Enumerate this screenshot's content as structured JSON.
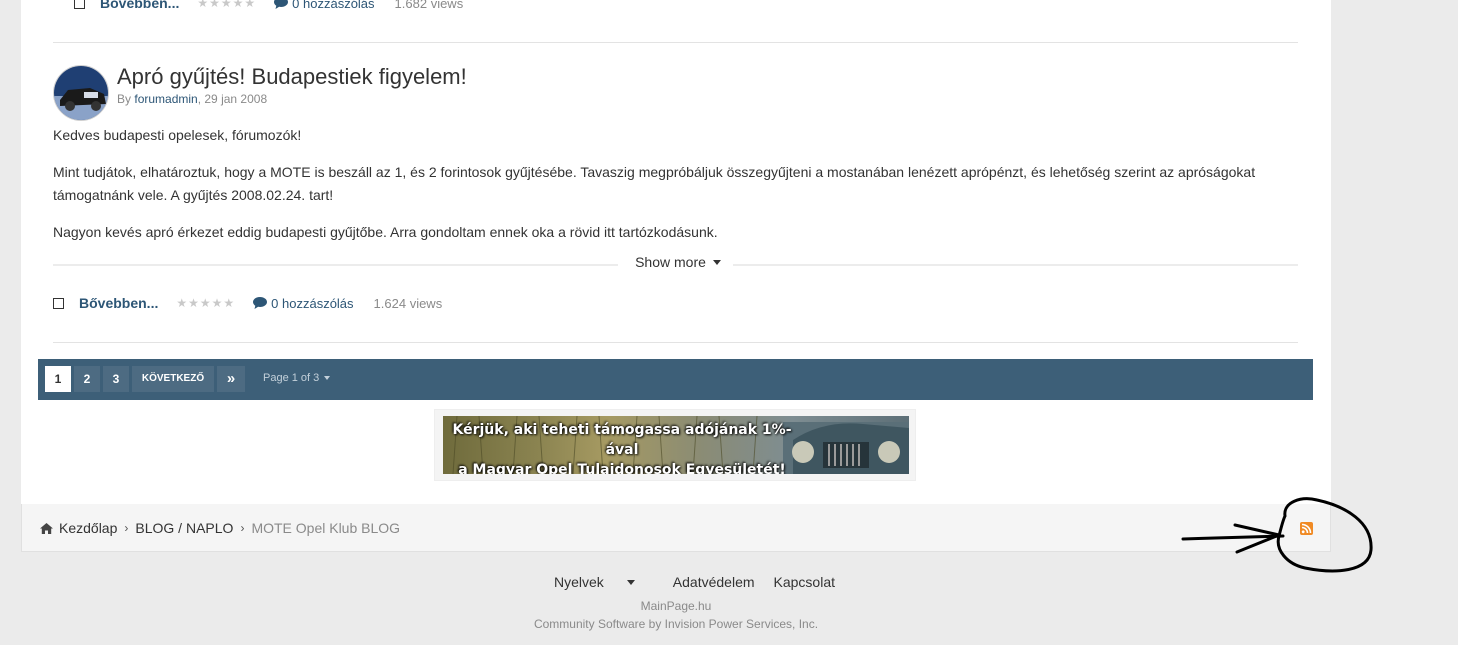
{
  "prev_entry": {
    "more_label": "Bővebben...",
    "comments": "0 hozzászólás",
    "views": "1.682 views"
  },
  "entry": {
    "title": "Apró gyűjtés! Budapestiek figyelem!",
    "by_prefix": "By",
    "author": "forumadmin",
    "date": ", 29 jan 2008",
    "paragraphs": [
      "Kedves budapesti opelesek, fórumozók!",
      "Mint tudjátok, elhatároztuk, hogy a MOTE is beszáll az 1, és 2 forintosok gyűjtésébe. Tavaszig megpróbáljuk összegyűjteni a mostanában lenézett aprópénzt, és lehetőség szerint az apróságokat támogatnánk vele. A gyűjtés 2008.02.24. tart!",
      "Nagyon kevés apró érkezet eddig budapesti gyűjtőbe. Arra gondoltam ennek oka a rövid itt tartózkodásunk."
    ],
    "show_more": "Show more",
    "more_label": "Bővebben...",
    "comments": "0 hozzászólás",
    "views": "1.624 views"
  },
  "pagination": {
    "pages": [
      "1",
      "2",
      "3"
    ],
    "active_page": "1",
    "next_label": "KÖVETKEZŐ",
    "last_label": "»",
    "page_info": "Page 1 of 3"
  },
  "banner": {
    "line1": "Kérjük, aki teheti támogassa adójának 1%-ával",
    "line2": "a Magyar Opel Tulajdonosok Egyesületét!"
  },
  "breadcrumb": {
    "home": "Kezdőlap",
    "section": "BLOG / NAPLO",
    "current": "MOTE Opel Klub BLOG"
  },
  "footer": {
    "languages": "Nyelvek",
    "privacy": "Adatvédelem",
    "contact": "Kapcsolat",
    "site": "MainPage.hu",
    "credit": "Community Software by Invision Power Services, Inc."
  },
  "colors": {
    "link": "#2d5676",
    "pagination_bg": "#3d5f78",
    "rss": "#f08a24"
  }
}
